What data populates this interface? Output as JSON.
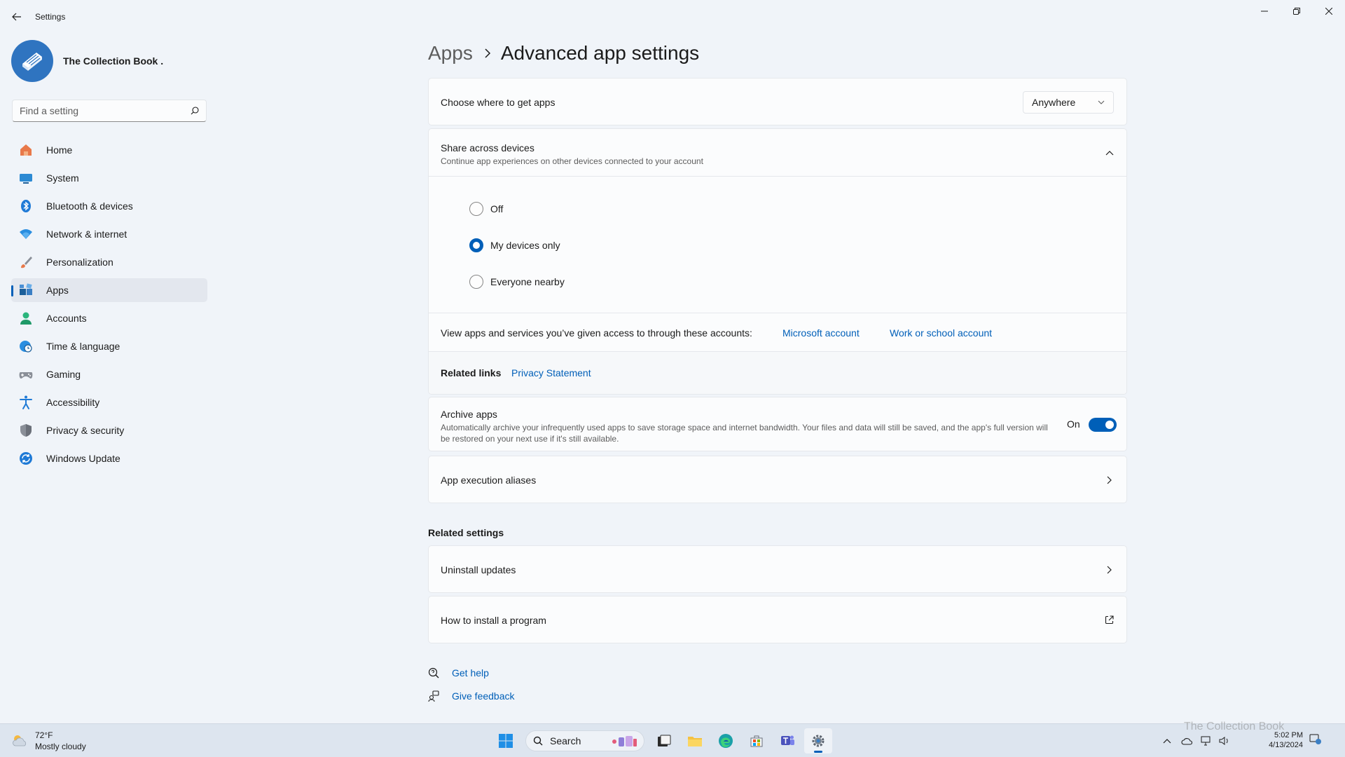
{
  "window": {
    "title": "Settings"
  },
  "profile": {
    "name": "The Collection Book ."
  },
  "search": {
    "placeholder": "Find a setting"
  },
  "sidebar": {
    "items": [
      {
        "label": "Home",
        "icon": "home-icon"
      },
      {
        "label": "System",
        "icon": "system-icon"
      },
      {
        "label": "Bluetooth & devices",
        "icon": "bluetooth-icon"
      },
      {
        "label": "Network & internet",
        "icon": "wifi-icon"
      },
      {
        "label": "Personalization",
        "icon": "brush-icon"
      },
      {
        "label": "Apps",
        "icon": "apps-icon",
        "active": true
      },
      {
        "label": "Accounts",
        "icon": "person-icon"
      },
      {
        "label": "Time & language",
        "icon": "globe-clock-icon"
      },
      {
        "label": "Gaming",
        "icon": "gamepad-icon"
      },
      {
        "label": "Accessibility",
        "icon": "accessibility-icon"
      },
      {
        "label": "Privacy & security",
        "icon": "shield-icon"
      },
      {
        "label": "Windows Update",
        "icon": "update-icon"
      }
    ]
  },
  "breadcrumb": {
    "parent": "Apps",
    "current": "Advanced app settings"
  },
  "main": {
    "get_apps": {
      "label": "Choose where to get apps",
      "value": "Anywhere"
    },
    "share": {
      "title": "Share across devices",
      "subtitle": "Continue app experiences on other devices connected to your account",
      "options": [
        "Off",
        "My devices only",
        "Everyone nearby"
      ],
      "selected": "My devices only",
      "accounts_text": "View apps and services you’ve given access to through these accounts:",
      "microsoft_account": "Microsoft account",
      "work_account": "Work or school account",
      "related_links_label": "Related links",
      "privacy_statement": "Privacy Statement"
    },
    "archive": {
      "title": "Archive apps",
      "description": "Automatically archive your infrequently used apps to save storage space and internet bandwidth. Your files and data will still be saved, and the app's full version will be restored on your next use if it's still available.",
      "state_label": "On",
      "enabled": true
    },
    "aliases": {
      "label": "App execution aliases"
    },
    "related_settings": {
      "heading": "Related settings",
      "uninstall": "Uninstall updates",
      "how_to_install": "How to install a program"
    },
    "help": {
      "get_help": "Get help",
      "give_feedback": "Give feedback"
    }
  },
  "taskbar": {
    "weather_temp": "72°F",
    "weather_desc": "Mostly cloudy",
    "search_label": "Search",
    "time": "5:02 PM",
    "date": "4/13/2024",
    "watermark": "The Collection Book"
  },
  "colors": {
    "accent": "#005fb8",
    "background": "#f0f4f9",
    "card": "#fbfcfd"
  }
}
